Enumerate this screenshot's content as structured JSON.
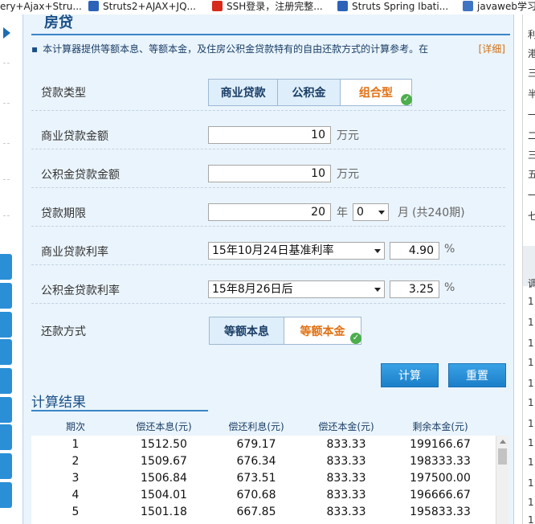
{
  "bookmarks": [
    {
      "label": "ery+Ajax+Stru...",
      "icon": "none"
    },
    {
      "label": "Struts2+AJAX+JQ...",
      "icon": "struts-icon"
    },
    {
      "label": "SSH登录，注册完整...",
      "icon": "ssh-icon"
    },
    {
      "label": "Struts Spring Ibati...",
      "icon": "struts-icon"
    },
    {
      "label": "javaweb学习",
      "icon": "javaweb-icon"
    }
  ],
  "calculator": {
    "title": "房贷",
    "intro": "本计算器提供等额本息、等额本金，及住房公积金贷款特有的自由还款方式的计算参考。在",
    "detail_link": "[详细]",
    "loan_type": {
      "label": "贷款类型",
      "options": [
        "商业贷款",
        "公积金",
        "组合型"
      ],
      "selected": "组合型"
    },
    "commercial_amount": {
      "label": "商业贷款金额",
      "value": "10",
      "unit": "万元"
    },
    "fund_amount": {
      "label": "公积金贷款金额",
      "value": "10",
      "unit": "万元"
    },
    "term": {
      "label": "贷款期限",
      "years": "20",
      "year_unit": "年",
      "months": "0",
      "month_unit": "月",
      "total": "(共240期)"
    },
    "commercial_rate": {
      "label": "商业贷款利率",
      "basis": "15年10月24日基准利率",
      "value": "4.90",
      "unit": "%"
    },
    "fund_rate": {
      "label": "公积金贷款利率",
      "basis": "15年8月26日后",
      "value": "3.25",
      "unit": "%"
    },
    "repayment": {
      "label": "还款方式",
      "options": [
        "等额本息",
        "等额本金"
      ],
      "selected": "等额本金"
    },
    "buttons": {
      "calculate": "计算",
      "reset": "重置"
    }
  },
  "results": {
    "title": "计算结果",
    "columns": [
      "期次",
      "偿还本息(元)",
      "偿还利息(元)",
      "偿还本金(元)",
      "剩余本金(元)"
    ],
    "rows": [
      [
        "1",
        "1512.50",
        "679.17",
        "833.33",
        "199166.67"
      ],
      [
        "2",
        "1509.67",
        "676.34",
        "833.33",
        "198333.33"
      ],
      [
        "3",
        "1506.84",
        "673.51",
        "833.33",
        "197500.00"
      ],
      [
        "4",
        "1504.01",
        "670.68",
        "833.33",
        "196666.67"
      ],
      [
        "5",
        "1501.18",
        "667.85",
        "833.33",
        "195833.33"
      ]
    ]
  },
  "right_sidebar": {
    "items": [
      "利",
      "港",
      "三",
      "半",
      "一",
      "二",
      "三",
      "五",
      "一",
      "七",
      "调",
      "1",
      "1",
      "1",
      "1",
      "1",
      "1",
      "1",
      "1",
      "1",
      "1",
      "1",
      "1",
      "1"
    ]
  },
  "colors": {
    "accent": "#1b7fc8",
    "selected_text": "#e07012",
    "panel_bg": "#eaf4fc",
    "title": "#1a4f86"
  }
}
